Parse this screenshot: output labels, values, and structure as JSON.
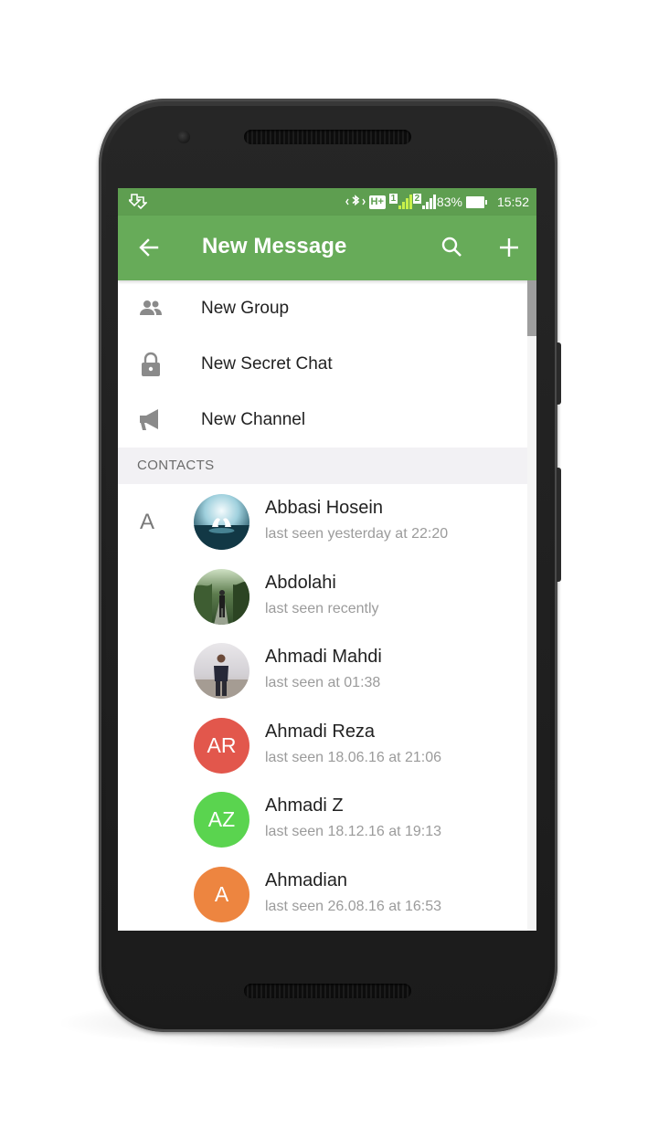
{
  "status_bar": {
    "network_type": "H+",
    "sim1": "1",
    "sim2": "2",
    "battery": "83%",
    "time": "15:52",
    "icons": [
      "download-icon",
      "bluetooth-icon",
      "signal-icon",
      "battery-icon"
    ]
  },
  "toolbar": {
    "title": "New Message",
    "color": "#67ab59",
    "icons": [
      "back-arrow-icon",
      "search-icon",
      "plus-icon"
    ]
  },
  "menu": [
    {
      "label": "New Group",
      "icon": "group-icon"
    },
    {
      "label": "New Secret Chat",
      "icon": "lock-icon"
    },
    {
      "label": "New Channel",
      "icon": "megaphone-icon"
    }
  ],
  "section": {
    "title": "CONTACTS",
    "letter": "A"
  },
  "contacts": [
    {
      "name": "Abbasi Hosein",
      "status": "last seen yesterday at 22:20",
      "avatar": "photo-swans"
    },
    {
      "name": "Abdolahi",
      "status": "last seen recently",
      "avatar": "photo-park"
    },
    {
      "name": "Ahmadi Mahdi",
      "status": "last seen at 01:38",
      "avatar": "photo-beach"
    },
    {
      "name": "Ahmadi Reza",
      "status": "last seen 18.06.16 at 21:06",
      "initials": "AR",
      "color": "#e2574c"
    },
    {
      "name": "Ahmadi Z",
      "status": "last seen 18.12.16 at 19:13",
      "initials": "AZ",
      "color": "#5ad44f"
    },
    {
      "name": "Ahmadian",
      "status": "last seen 26.08.16 at 16:53",
      "initials": "A",
      "color": "#ed8540"
    }
  ]
}
